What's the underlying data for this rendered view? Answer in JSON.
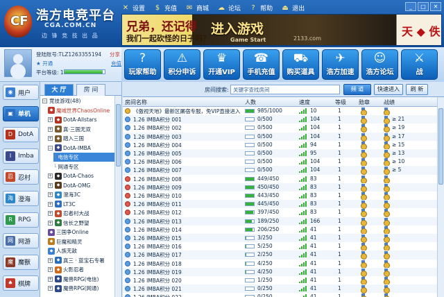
{
  "app": {
    "logo_text": "浩方电竞平台",
    "site": "CGA.COM.CN",
    "slogan": "边 锋 竞 技 出 品"
  },
  "top_menu": [
    {
      "label": "设置",
      "icon": "wrench-icon",
      "glyph": "✕"
    },
    {
      "label": "充值",
      "icon": "dollar-icon",
      "glyph": "$"
    },
    {
      "label": "商城",
      "icon": "mail-icon",
      "glyph": "✉"
    },
    {
      "label": "论坛",
      "icon": "chat-icon",
      "glyph": "☁"
    },
    {
      "label": "帮助",
      "icon": "help-icon",
      "glyph": "?"
    },
    {
      "label": "退出",
      "icon": "exit-icon",
      "glyph": "⏏"
    }
  ],
  "banner": {
    "line1": "兄弟，还记得",
    "line2": "我们一起砍怪的日子吗？",
    "cta": "进入游戏",
    "cta_sub": "Game Start",
    "site": "2133.com",
    "brand": "天 ◆ 佚"
  },
  "user": {
    "account_label": "登陆账号:TLZ1263355194",
    "share": "分享",
    "stars": "★ 开通",
    "recharge": "充值",
    "level_label": "平台等级: 18",
    "level_progress": 0.95
  },
  "quick_buttons": [
    {
      "label": "玩家帮助",
      "icon": "question-icon",
      "glyph": "?"
    },
    {
      "label": "积分申诉",
      "icon": "report-icon",
      "glyph": "⚠"
    },
    {
      "label": "开通VIP",
      "icon": "vip-icon",
      "glyph": "♛"
    },
    {
      "label": "手机充值",
      "icon": "phone-icon",
      "glyph": "☎"
    },
    {
      "label": "购买道具",
      "icon": "cart-icon",
      "glyph": "⛟"
    },
    {
      "label": "浩方加速",
      "icon": "speed-icon",
      "glyph": "✈"
    },
    {
      "label": "浩方论坛",
      "icon": "forum-icon",
      "glyph": "☺"
    },
    {
      "label": "战",
      "icon": "battle-icon",
      "glyph": "⚔"
    }
  ],
  "side_nav": [
    {
      "label": "用户",
      "icon": "user-icon",
      "color": "#3b7fd0",
      "glyph": "◉"
    },
    {
      "label": "单机",
      "icon": "single-icon",
      "color": "#2a6ebf",
      "glyph": "▣",
      "active": true
    },
    {
      "label": "DotA",
      "icon": "dota-icon",
      "color": "#b3331e",
      "glyph": "D"
    },
    {
      "label": "Imba",
      "icon": "imba-icon",
      "color": "#3c4a8c",
      "glyph": "I"
    },
    {
      "label": "忍村",
      "icon": "ninja-icon",
      "color": "#c24a2a",
      "glyph": "忍"
    },
    {
      "label": "澄海",
      "icon": "sea-icon",
      "color": "#2e88c8",
      "glyph": "海"
    },
    {
      "label": "RPG",
      "icon": "rpg-icon",
      "color": "#2f9a4e",
      "glyph": "R"
    },
    {
      "label": "网游",
      "icon": "online-icon",
      "color": "#4a6fa8",
      "glyph": "网"
    },
    {
      "label": "魔獸",
      "icon": "warcraft-icon",
      "color": "#8a3a26",
      "glyph": "魔"
    },
    {
      "label": "棋牌",
      "icon": "cards-icon",
      "color": "#c0392b",
      "glyph": "♠"
    }
  ],
  "room_tabs": [
    "大 厅",
    "房 间"
  ],
  "tree": [
    {
      "label": "竞技游戏(48)",
      "level": 0,
      "pm": "−"
    },
    {
      "label": "魔域世界ChaosOnline",
      "level": 1,
      "color": "#c0392b",
      "red": true
    },
    {
      "label": "DotA-Allstars",
      "level": 1,
      "pm": "+",
      "color": "#b3331e"
    },
    {
      "label": "真·三国无双",
      "level": 1,
      "pm": "+",
      "color": "#7a5a2a"
    },
    {
      "label": "踏入三国",
      "level": 1,
      "pm": "+",
      "color": "#7a5a2a"
    },
    {
      "label": "DotA-IMBA",
      "level": 1,
      "pm": "−",
      "color": "#3c4a8c"
    },
    {
      "label": "电信专区",
      "level": 2,
      "sel": true
    },
    {
      "label": "网通专区",
      "level": 2
    },
    {
      "label": "DotA-Chaos",
      "level": 1,
      "pm": "+",
      "color": "#2a2a2a"
    },
    {
      "label": "DotA-OMG",
      "level": 1,
      "pm": "+",
      "color": "#5a3a1a"
    },
    {
      "label": "澄海3C",
      "level": 1,
      "pm": "+",
      "color": "#2e88c8"
    },
    {
      "label": "LT3C",
      "level": 1,
      "pm": "+",
      "color": "#2a6ebf"
    },
    {
      "label": "忍者村大战",
      "level": 1,
      "pm": "+",
      "color": "#c24a2a"
    },
    {
      "label": "信长之野望",
      "level": 1,
      "pm": "+",
      "color": "#2f7a3e"
    },
    {
      "label": "三国争Online",
      "level": 1,
      "color": "#6a4a9a"
    },
    {
      "label": "巨魔和精灵",
      "level": 1,
      "color": "#c07a1a"
    },
    {
      "label": "人族无敌",
      "level": 1,
      "color": "#3b7fd0"
    },
    {
      "label": "真三 · 蓝宝石专署",
      "level": 1,
      "pm": "+",
      "color": "#2a6ebf"
    },
    {
      "label": "火影忍者",
      "level": 1,
      "pm": "+",
      "color": "#d06a1a"
    },
    {
      "label": "魔兽RPG(电信)",
      "level": 1,
      "pm": "+",
      "color": "#2a4a8a"
    },
    {
      "label": "魔兽RPG(网通)",
      "level": 1,
      "pm": "+",
      "color": "#2a4a8a"
    }
  ],
  "search": {
    "label": "房间搜索:",
    "placeholder": "关键字查找房间",
    "button": "频 道",
    "quick_enter": "快速进入",
    "refresh": "刷 新"
  },
  "list_headers": [
    "房间名称",
    "人数",
    "速度",
    "等级",
    "勋章",
    "战绩"
  ],
  "rooms": [
    {
      "name": "《傲视天地》最新区屠宿专服，免VIP直接进入",
      "count": "985/1000",
      "fill": 0.98,
      "speed": "10",
      "level": "1",
      "record": "",
      "icon": "lock"
    },
    {
      "name": "1.26 IMBA积分 001",
      "count": "0/500",
      "fill": 0,
      "speed": "104",
      "level": "1",
      "record": "≥ 21",
      "icon": ""
    },
    {
      "name": "1.26 IMBA积分 002",
      "count": "0/500",
      "fill": 0,
      "speed": "104",
      "level": "1",
      "record": "≥ 19",
      "icon": ""
    },
    {
      "name": "1.26 IMBA积分 003",
      "count": "0/500",
      "fill": 0,
      "speed": "104",
      "level": "1",
      "record": "≥ 17",
      "icon": ""
    },
    {
      "name": "1.26 IMBA积分 004",
      "count": "0/500",
      "fill": 0,
      "speed": "94",
      "level": "1",
      "record": "≥ 15",
      "icon": ""
    },
    {
      "name": "1.26 IMBA积分 005",
      "count": "0/500",
      "fill": 0,
      "speed": "95",
      "level": "1",
      "record": "≥ 13",
      "icon": ""
    },
    {
      "name": "1.26 IMBA积分 006",
      "count": "0/500",
      "fill": 0,
      "speed": "104",
      "level": "1",
      "record": "≥ 10",
      "icon": ""
    },
    {
      "name": "1.26 IMBA积分 007",
      "count": "0/500",
      "fill": 0,
      "speed": "104",
      "level": "1",
      "record": "≥ 5",
      "icon": ""
    },
    {
      "name": "1.26 IMBA积分 008",
      "count": "449/450",
      "fill": 0.99,
      "speed": "83",
      "level": "1",
      "record": "",
      "icon": "red"
    },
    {
      "name": "1.26 IMBA积分 009",
      "count": "450/450",
      "fill": 1,
      "speed": "83",
      "level": "1",
      "record": "",
      "icon": "red"
    },
    {
      "name": "1.26 IMBA积分 010",
      "count": "443/450",
      "fill": 0.98,
      "speed": "83",
      "level": "1",
      "record": "",
      "icon": "red"
    },
    {
      "name": "1.26 IMBA积分 011",
      "count": "445/450",
      "fill": 0.99,
      "speed": "83",
      "level": "1",
      "record": "",
      "icon": "red"
    },
    {
      "name": "1.26 IMBA积分 012",
      "count": "397/450",
      "fill": 0.88,
      "speed": "83",
      "level": "1",
      "record": "",
      "icon": "red"
    },
    {
      "name": "1.26 IMBA积分 013",
      "count": "189/250",
      "fill": 0.76,
      "speed": "166",
      "level": "1",
      "record": "",
      "icon": ""
    },
    {
      "name": "1.26 IMBA积分 014",
      "count": "206/250",
      "fill": 0.82,
      "speed": "41",
      "level": "1",
      "record": "",
      "icon": ""
    },
    {
      "name": "1.26 IMBA积分 015",
      "count": "3/250",
      "fill": 0.01,
      "speed": "41",
      "level": "1",
      "record": "",
      "icon": ""
    },
    {
      "name": "1.26 IMBA积分 016",
      "count": "5/250",
      "fill": 0.02,
      "speed": "41",
      "level": "1",
      "record": "",
      "icon": ""
    },
    {
      "name": "1.26 IMBA积分 017",
      "count": "2/250",
      "fill": 0.01,
      "speed": "41",
      "level": "1",
      "record": "",
      "icon": ""
    },
    {
      "name": "1.26 IMBA积分 018",
      "count": "4/250",
      "fill": 0.02,
      "speed": "41",
      "level": "1",
      "record": "",
      "icon": ""
    },
    {
      "name": "1.26 IMBA积分 019",
      "count": "4/250",
      "fill": 0.02,
      "speed": "41",
      "level": "1",
      "record": "",
      "icon": ""
    },
    {
      "name": "1.26 IMBA积分 020",
      "count": "1/250",
      "fill": 0.004,
      "speed": "41",
      "level": "1",
      "record": "",
      "icon": ""
    },
    {
      "name": "1.26 IMBA积分 021",
      "count": "0/250",
      "fill": 0,
      "speed": "41",
      "level": "1",
      "record": "",
      "icon": ""
    },
    {
      "name": "1.26 IMBA积分 022",
      "count": "0/250",
      "fill": 0,
      "speed": "41",
      "level": "1",
      "record": "",
      "icon": ""
    },
    {
      "name": "1.26 IMBA积分 023",
      "count": "0/250",
      "fill": 0,
      "speed": "41",
      "level": "1",
      "record": "",
      "icon": ""
    }
  ]
}
